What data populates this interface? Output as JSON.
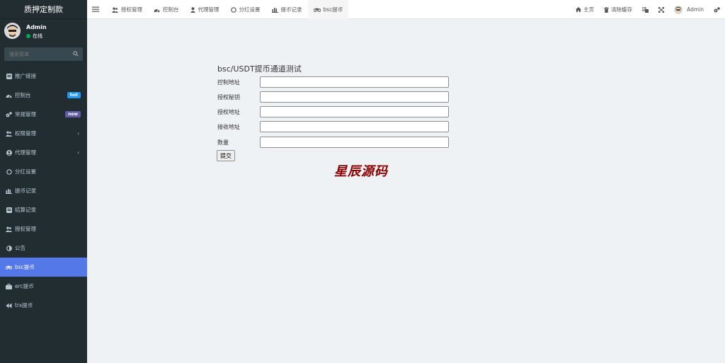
{
  "brand": "质押定制款",
  "user": {
    "name": "Admin",
    "status": "在线"
  },
  "search": {
    "placeholder": "搜索菜单"
  },
  "sidebar": {
    "items": [
      {
        "label": "推广链接",
        "icon": "list-icon"
      },
      {
        "label": "控制台",
        "icon": "dashboard-icon",
        "badge": "hot"
      },
      {
        "label": "常规管理",
        "icon": "cogs-icon",
        "badge": "new"
      },
      {
        "label": "权限管理",
        "icon": "users-icon",
        "chevron": "‹"
      },
      {
        "label": "代理管理",
        "icon": "user-circle-icon",
        "chevron": "‹"
      },
      {
        "label": "分红设置",
        "icon": "circle-icon"
      },
      {
        "label": "提币记录",
        "icon": "bar-chart-icon"
      },
      {
        "label": "结算记录",
        "icon": "list-icon"
      },
      {
        "label": "授权管理",
        "icon": "users-icon"
      },
      {
        "label": "公告",
        "icon": "half-circle-icon"
      },
      {
        "label": "bsc提币",
        "icon": "bicycle-icon"
      },
      {
        "label": "erc提币",
        "icon": "briefcase-icon"
      },
      {
        "label": "trx提币",
        "icon": "backward-icon"
      }
    ]
  },
  "topbar": {
    "tabs": [
      {
        "label": "授权管理",
        "icon": "users-icon"
      },
      {
        "label": "控制台",
        "icon": "dashboard-icon"
      },
      {
        "label": "代理管理",
        "icon": "user-icon"
      },
      {
        "label": "分红设置",
        "icon": "circle-icon"
      },
      {
        "label": "提币记录",
        "icon": "bar-chart-icon"
      },
      {
        "label": "bsc提币",
        "icon": "bicycle-icon"
      }
    ],
    "home": "主页",
    "clear_cache": "清除缓存",
    "admin": "Admin"
  },
  "form": {
    "title": "bsc/USDT提币通道测试",
    "fields": [
      {
        "label": "控制地址",
        "value": ""
      },
      {
        "label": "授权秘钥",
        "value": ""
      },
      {
        "label": "授权地址",
        "value": ""
      },
      {
        "label": "接收地址",
        "value": ""
      },
      {
        "label": "数量",
        "value": ""
      }
    ],
    "submit": "提交"
  },
  "watermark": "星辰源码",
  "colors": {
    "sidebar": "#222d32",
    "active": "#5578e8",
    "hot": "#2196f3",
    "new": "#605ca8",
    "online": "#00a65a",
    "watermark": "#8b0000"
  }
}
